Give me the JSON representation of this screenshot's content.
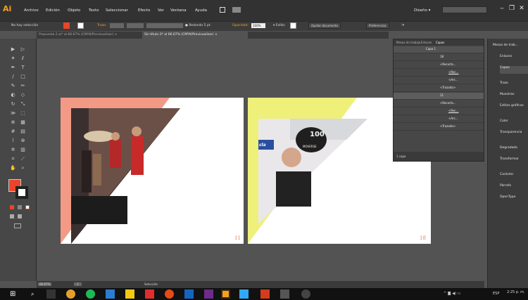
{
  "app": {
    "logo": "Ai",
    "workspace": "Diseño",
    "workspace_arrow": "▾"
  },
  "menu": [
    "Archivo",
    "Edición",
    "Objeto",
    "Texto",
    "Seleccionar",
    "Efecto",
    "Ver",
    "Ventana",
    "Ayuda"
  ],
  "window_controls": {
    "minimize": "‒",
    "restore": "❐",
    "close": "✕"
  },
  "control_bar": {
    "selection": "No hay selección",
    "stroke_label": "Trazo:",
    "brush": "Redondo 5 pt.",
    "opacity_label": "Opacidad:",
    "opacity_value": "100%",
    "style_label": "Estilo:",
    "doc_setup": "Ajustar documento",
    "preferences": "Preferencias"
  },
  "tabs": [
    {
      "label": "Propuesta 2.ai* al 66.67% (CMYK/Previsualizar)",
      "close": "×"
    },
    {
      "label": "Sin título-3* al 66.67% (CMYK/Previsualizar)",
      "close": "×"
    }
  ],
  "artboards": [
    {
      "page_number": "11"
    },
    {
      "page_number": "18"
    }
  ],
  "photo2": {
    "logo_text": "100",
    "logo_sub": "MOVERSE",
    "sign": "cla"
  },
  "layers_panel": {
    "tabs": [
      "Mesas de trabajo",
      "Enlaces",
      "Capas"
    ],
    "rows": [
      "Capa 1",
      "18",
      "<Recorta...",
      "<Rec...",
      "<Arc...",
      "<Trazado>",
      "11",
      "<Recorta...",
      "<Rec...",
      "<Arc...",
      "<Trazado>"
    ],
    "footer": "1 capa"
  },
  "dock": [
    "Mesas de trab...",
    "Enlaces",
    "Capas",
    "Trazo",
    "Muestras",
    "Estilos gráficos",
    "Color",
    "Transparencia",
    "Degradado",
    "Transformar",
    "Carácter",
    "Párrafo",
    "OpenType"
  ],
  "status": {
    "zoom": "66.67%",
    "page": "1",
    "mode": "Selección"
  },
  "taskbar": {
    "lang": "ESP",
    "time": "2:25 p. m."
  },
  "colors": {
    "accent_red": "#e8452a",
    "salmon": "#f29a85",
    "yellow": "#eef07a",
    "page_num": "#e07a5f"
  }
}
